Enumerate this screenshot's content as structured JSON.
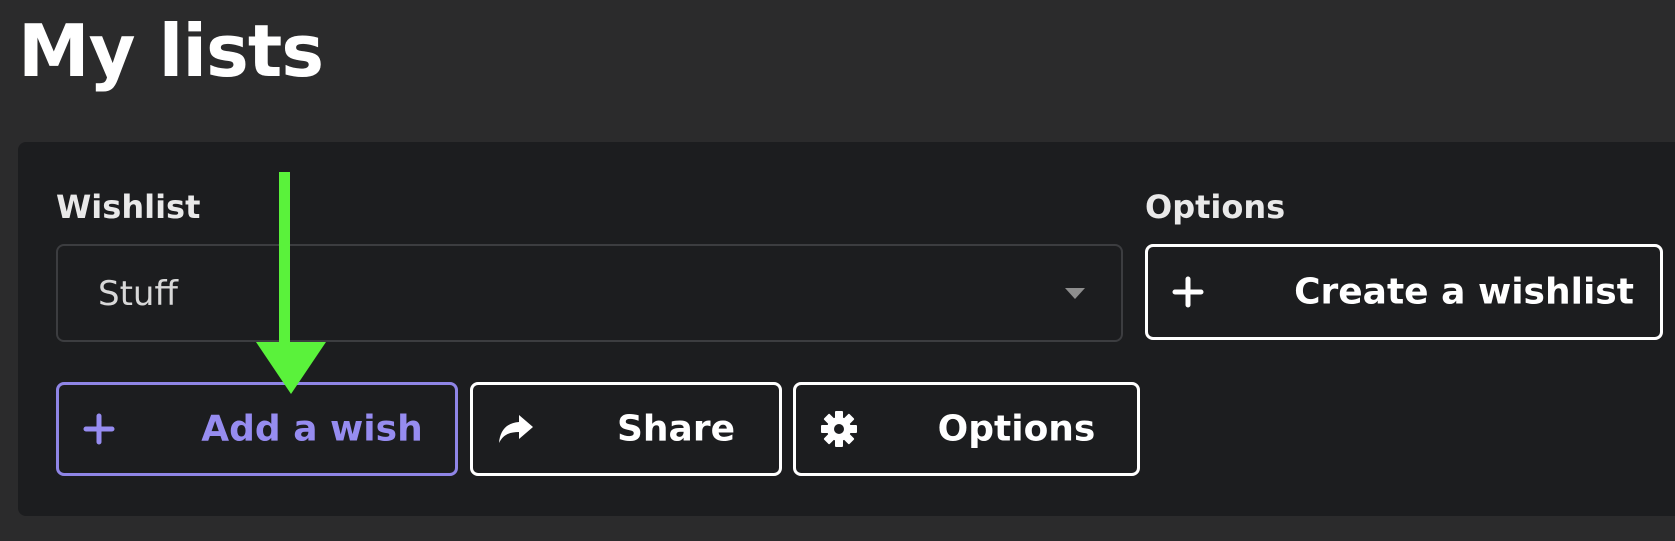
{
  "page": {
    "title": "My lists"
  },
  "wishlist": {
    "label": "Wishlist",
    "selected": "Stuff"
  },
  "options": {
    "label": "Options",
    "create_label": "Create a wishlist"
  },
  "actions": {
    "add_label": "Add a wish",
    "share_label": "Share",
    "options_label": "Options"
  },
  "colors": {
    "accent": "#968cf0",
    "arrow": "#5af23b",
    "background": "#2b2b2c",
    "panel": "#1c1d1f"
  },
  "icons": [
    "plus-icon",
    "share-icon",
    "gear-icon",
    "chevron-down-icon",
    "arrow-annotation"
  ]
}
